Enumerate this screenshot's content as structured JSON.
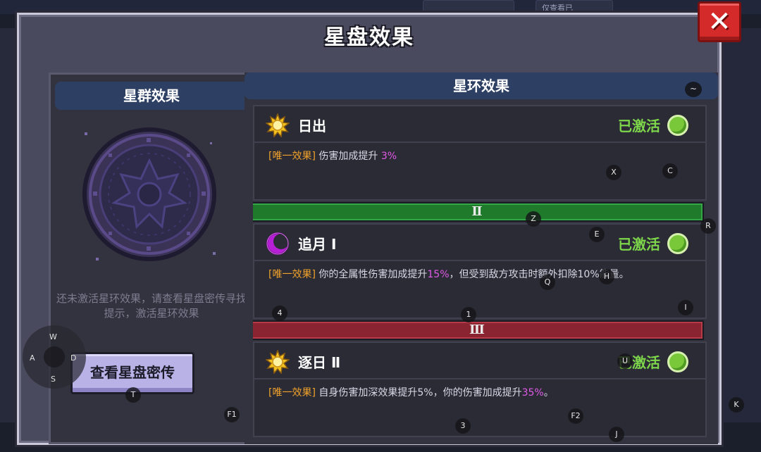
{
  "title": "星盘效果",
  "close_label": "✕",
  "left": {
    "header": "星群效果",
    "hint": "还未激活星环效果，请查看星盘密传寻找提示，激活星环效果",
    "button": "查看星盘密传"
  },
  "right": {
    "header": "星环效果",
    "effects": [
      {
        "name": "日出",
        "status": "已激活",
        "tag": "[唯一效果]",
        "desc_before": " 伤害加成提升 ",
        "desc_highlight": "3%",
        "desc_after": ""
      },
      {
        "name": "追月 Ⅰ",
        "status": "已激活",
        "tag": "[唯一效果]",
        "desc_before": " 你的全属性伤害加成提升",
        "desc_highlight": "15%",
        "desc_after": "，但受到敌方攻击时额外扣除10%能量。"
      },
      {
        "name": "逐日 Ⅱ",
        "status": "已激活",
        "tag": "[唯一效果]",
        "desc_before": " 自身伤害加深效果提升5%，你的伤害加成提升",
        "desc_highlight": "35%",
        "desc_after": "。"
      }
    ],
    "dividers": [
      "Ⅱ",
      "Ⅲ"
    ]
  },
  "key_hints": [
    "~",
    "X",
    "C",
    "Z",
    "R",
    "E",
    "Q",
    "H",
    "4",
    "1",
    "I",
    "U",
    "K",
    "T",
    "F1",
    "F2",
    "3",
    "J",
    "W",
    "A",
    "D",
    "S"
  ],
  "background": {
    "chip_top": "仅查看已"
  },
  "colors": {
    "header_bg": "#2d3f63",
    "active_green": "#7ed64a",
    "tag_orange": "#f0a22a",
    "highlight_magenta": "#e05ae6",
    "divider_green": "#1f7a2c",
    "divider_red": "#8a2430",
    "close_red": "#d42a2a"
  }
}
